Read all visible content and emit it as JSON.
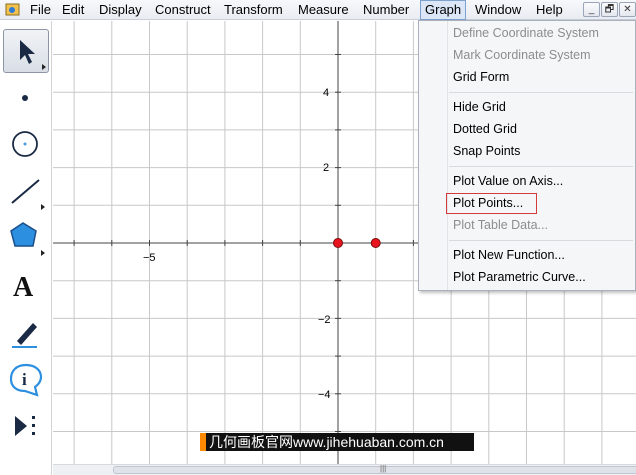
{
  "menubar": {
    "items": [
      "File",
      "Edit",
      "Display",
      "Construct",
      "Transform",
      "Measure",
      "Number",
      "Graph",
      "Window",
      "Help"
    ],
    "active": "Graph",
    "window_controls": [
      "_",
      "🗗",
      "✕"
    ]
  },
  "toolbox": {
    "tools": [
      "arrow-tool",
      "point-tool",
      "compass-tool",
      "straightedge-tool",
      "polygon-tool",
      "text-tool",
      "marker-tool",
      "information-tool",
      "custom-tool"
    ],
    "text_tool_glyph": "A",
    "info_glyph": "i"
  },
  "graph": {
    "x_tick_labels": [
      "−5"
    ],
    "y_tick_labels": [
      "4",
      "2",
      "−2",
      "−4"
    ],
    "plotted_points": [
      {
        "x": 0,
        "y": 0
      },
      {
        "x": 1,
        "y": 0
      }
    ],
    "point_color": "#e8141e",
    "grid_color": "#c8c8c8"
  },
  "graph_menu": {
    "items": [
      {
        "label": "Define Coordinate System",
        "enabled": false
      },
      {
        "label": "Mark Coordinate System",
        "enabled": false
      },
      {
        "label": "Grid Form",
        "enabled": true
      },
      {
        "label": "Hide Grid",
        "enabled": true
      },
      {
        "label": "Dotted Grid",
        "enabled": true
      },
      {
        "label": "Snap Points",
        "enabled": true
      },
      {
        "label": "Plot Value on Axis...",
        "enabled": true
      },
      {
        "label": "Plot Points...",
        "enabled": true,
        "highlighted": true
      },
      {
        "label": "Plot Table Data...",
        "enabled": false
      },
      {
        "label": "Plot New Function...",
        "enabled": true
      },
      {
        "label": "Plot Parametric Curve...",
        "enabled": true
      }
    ],
    "highlight_color": "#d43c3c"
  },
  "watermark": {
    "text": "几何画板官网www.jihehuaban.com.cn",
    "accent": "#ff8a00"
  },
  "scrollbar": {
    "grip": "|||"
  }
}
